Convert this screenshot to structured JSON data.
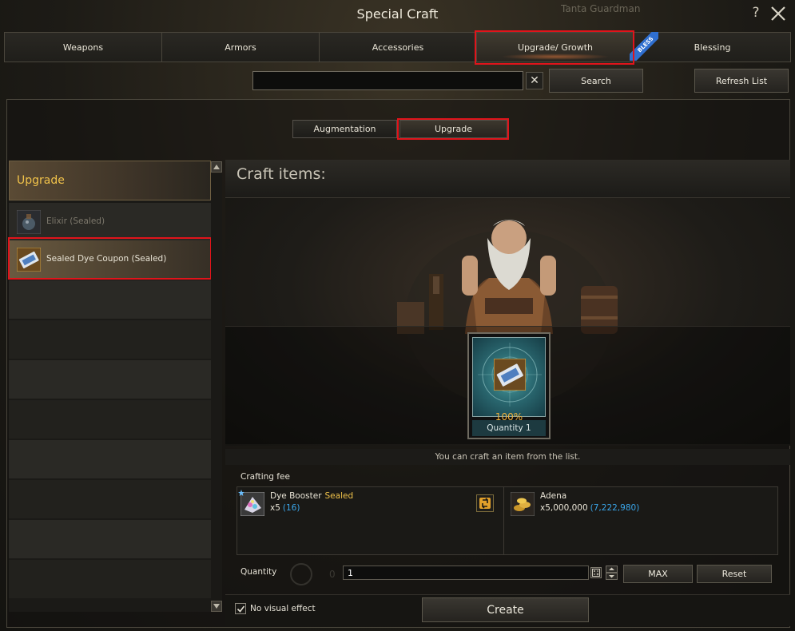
{
  "window": {
    "title": "Special Craft",
    "background_name": "Tanta Guardman",
    "help_label": "?"
  },
  "main_tabs": [
    {
      "label": "Weapons"
    },
    {
      "label": "Armors"
    },
    {
      "label": "Accessories"
    },
    {
      "label": "Upgrade/ Growth",
      "active": true
    },
    {
      "label": "Blessing"
    }
  ],
  "bless_ribbon": "BLESS",
  "search": {
    "value": "",
    "placeholder": "",
    "clear_label": "✕",
    "search_label": "Search",
    "refresh_label": "Refresh List"
  },
  "sub_tabs": [
    {
      "label": "Augmentation"
    },
    {
      "label": "Upgrade",
      "active": true
    }
  ],
  "sidebar": {
    "header": "Upgrade",
    "items": [
      {
        "label": "Elixir (Sealed)",
        "state": "disabled",
        "icon": "elixir-icon"
      },
      {
        "label": "Sealed Dye Coupon (Sealed)",
        "state": "selected",
        "icon": "dye-coupon-icon"
      }
    ]
  },
  "craft": {
    "title": "Craft items:",
    "result": {
      "icon": "dye-coupon-icon",
      "rate": "100%",
      "quantity_label": "Quantity 1"
    },
    "hint": "You can craft an item from the list.",
    "fee_label": "Crafting fee",
    "fees": [
      {
        "name": "Dye Booster",
        "tag": "Sealed",
        "amount": "x5",
        "owned": "(16)",
        "icon": "dye-booster-icon"
      },
      {
        "name": "Adena",
        "tag": "",
        "amount": "x5,000,000",
        "owned": "(7,222,980)",
        "icon": "adena-coins-icon"
      }
    ],
    "quantity": {
      "label": "Quantity",
      "value": "1",
      "max_label": "MAX",
      "reset_label": "Reset"
    },
    "no_visual_effect": {
      "label": "No visual effect",
      "checked": true
    },
    "create_label": "Create"
  },
  "colors": {
    "accent_gold": "#f0c24a",
    "owned_blue": "#3aa6ea",
    "highlight_red": "#e0141b",
    "rate_orange": "#f0b23c"
  }
}
